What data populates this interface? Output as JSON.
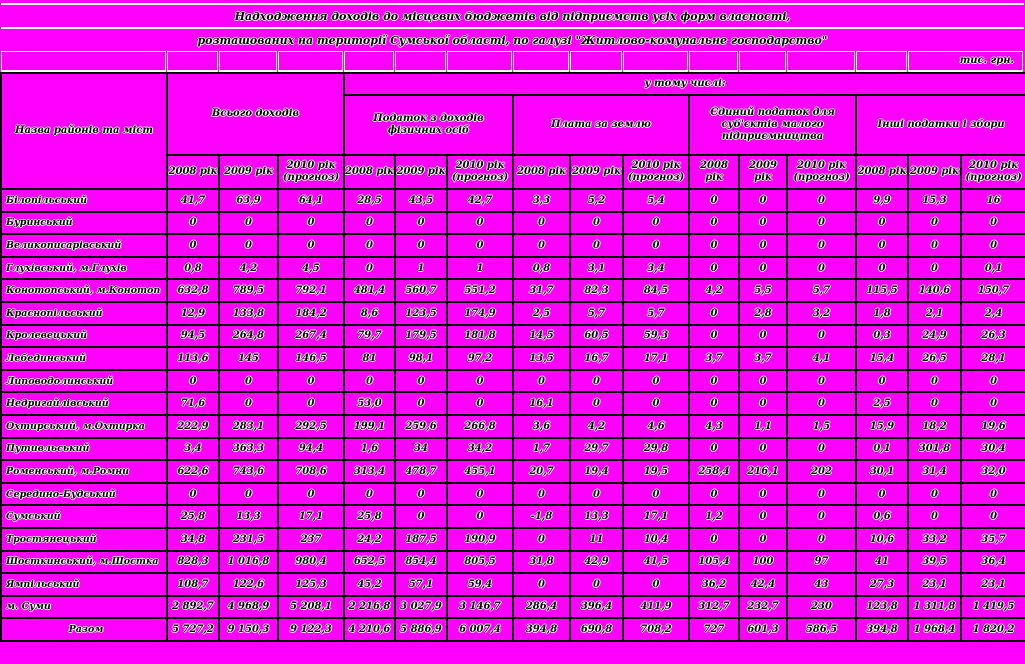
{
  "title_line1": "Надходження доходів до місцевих бюджетів від підприємств усіх форм власності,",
  "title_line2": "розташованих на території Сумської області, по галузі \"Житлово-комунальне господарство\"",
  "unit": "тис. грн.",
  "header": {
    "name_col": "Назва районів та міст",
    "total_group": "Всього доходів",
    "including": "у тому числі:",
    "groups": [
      "Податок з доходів фізичних осіб",
      "Плата за землю",
      "Єдиний податок для суб'єктів малого підприємництва",
      "Інші податки і збори"
    ],
    "years": [
      "2008 рік",
      "2009 рік",
      "2010 рік (прогноз)"
    ]
  },
  "rows": [
    {
      "name": "Білопільський",
      "v": [
        "41,7",
        "63,9",
        "64,1",
        "28,5",
        "43,5",
        "42,7",
        "3,3",
        "5,2",
        "5,4",
        "0",
        "0",
        "0",
        "9,9",
        "15,3",
        "16"
      ]
    },
    {
      "name": "Буринський",
      "v": [
        "0",
        "0",
        "0",
        "0",
        "0",
        "0",
        "0",
        "0",
        "0",
        "0",
        "0",
        "0",
        "0",
        "0",
        "0"
      ]
    },
    {
      "name": "Великописарівський",
      "v": [
        "0",
        "0",
        "0",
        "0",
        "0",
        "0",
        "0",
        "0",
        "0",
        "0",
        "0",
        "0",
        "0",
        "0",
        "0"
      ]
    },
    {
      "name": "Глухівський, м.Глухів",
      "v": [
        "0,8",
        "4,2",
        "4,5",
        "0",
        "1",
        "1",
        "0,8",
        "3,1",
        "3,4",
        "0",
        "0",
        "0",
        "0",
        "0",
        "0,1"
      ]
    },
    {
      "name": "Конотопський, м.Конотоп",
      "v": [
        "632,8",
        "789,5",
        "792,1",
        "481,4",
        "560,7",
        "551,2",
        "31,7",
        "82,3",
        "84,5",
        "4,2",
        "5,5",
        "5,7",
        "115,5",
        "140,6",
        "150,7"
      ]
    },
    {
      "name": "Краснопільський",
      "v": [
        "12,9",
        "133,8",
        "184,2",
        "8,6",
        "123,5",
        "174,9",
        "2,5",
        "5,7",
        "5,7",
        "0",
        "2,8",
        "3,2",
        "1,8",
        "2,1",
        "2,4"
      ]
    },
    {
      "name": "Кролевецький",
      "v": [
        "94,5",
        "264,8",
        "267,4",
        "79,7",
        "179,5",
        "181,8",
        "14,5",
        "60,5",
        "59,3",
        "0",
        "0",
        "0",
        "0,3",
        "24,9",
        "26,3"
      ]
    },
    {
      "name": "Лебединський",
      "v": [
        "113,6",
        "145",
        "146,5",
        "81",
        "98,1",
        "97,2",
        "13,5",
        "16,7",
        "17,1",
        "3,7",
        "3,7",
        "4,1",
        "15,4",
        "26,5",
        "28,1"
      ]
    },
    {
      "name": "Липоводолинський",
      "v": [
        "0",
        "0",
        "0",
        "0",
        "0",
        "0",
        "0",
        "0",
        "0",
        "0",
        "0",
        "0",
        "0",
        "0",
        "0"
      ]
    },
    {
      "name": "Недригайлівський",
      "v": [
        "71,6",
        "0",
        "0",
        "53,0",
        "0",
        "0",
        "16,1",
        "0",
        "0",
        "0",
        "0",
        "0",
        "2,5",
        "0",
        "0"
      ]
    },
    {
      "name": "Охтирський, м.Охтирка",
      "v": [
        "222,9",
        "283,1",
        "292,5",
        "199,1",
        "259,6",
        "266,8",
        "3,6",
        "4,2",
        "4,6",
        "4,3",
        "1,1",
        "1,5",
        "15,9",
        "18,2",
        "19,6"
      ]
    },
    {
      "name": "Путивльський",
      "v": [
        "3,4",
        "363,3",
        "94,4",
        "1,6",
        "34",
        "34,2",
        "1,7",
        "29,7",
        "29,8",
        "0",
        "0",
        "0",
        "0,1",
        "301,8",
        "30,4"
      ]
    },
    {
      "name": "Роменський, м.Ромни",
      "v": [
        "622,6",
        "743,6",
        "708,6",
        "313,4",
        "478,7",
        "455,1",
        "20,7",
        "19,4",
        "19,5",
        "258,4",
        "216,1",
        "202",
        "30,1",
        "31,4",
        "32,0"
      ]
    },
    {
      "name": "Середино-Будський",
      "v": [
        "0",
        "0",
        "0",
        "0",
        "0",
        "0",
        "0",
        "0",
        "0",
        "0",
        "0",
        "0",
        "0",
        "0",
        "0"
      ]
    },
    {
      "name": "Сумський",
      "v": [
        "25,8",
        "13,3",
        "17,1",
        "25,8",
        "0",
        "0",
        "-1,8",
        "13,3",
        "17,1",
        "1,2",
        "0",
        "0",
        "0,6",
        "0",
        "0"
      ]
    },
    {
      "name": "Тростянецький",
      "v": [
        "34,8",
        "231,5",
        "237",
        "24,2",
        "187,5",
        "190,9",
        "0",
        "11",
        "10,4",
        "0",
        "0",
        "0",
        "10,6",
        "33,2",
        "35,7"
      ]
    },
    {
      "name": "Шосткинський, м.Шостка",
      "v": [
        "828,3",
        "1 016,8",
        "980,4",
        "652,5",
        "854,4",
        "805,5",
        "31,8",
        "42,9",
        "41,5",
        "105,4",
        "100",
        "97",
        "41",
        "39,5",
        "36,4"
      ]
    },
    {
      "name": "Ямпільський",
      "v": [
        "108,7",
        "122,6",
        "125,3",
        "45,2",
        "57,1",
        "59,4",
        "0",
        "0",
        "0",
        "36,2",
        "42,4",
        "43",
        "27,3",
        "23,1",
        "23,1"
      ]
    },
    {
      "name": "м. Суми",
      "v": [
        "2 892,7",
        "4 968,9",
        "5 208,1",
        "2 216,8",
        "3 027,9",
        "3 146,7",
        "286,4",
        "396,4",
        "411,9",
        "312,7",
        "232,7",
        "230",
        "123,8",
        "1 311,8",
        "1 419,5"
      ]
    }
  ],
  "total": {
    "name": "Разом",
    "v": [
      "5 727,2",
      "9 150,3",
      "9 122,3",
      "4 210,6",
      "5 886,9",
      "6 007,4",
      "394,8",
      "690,8",
      "708,2",
      "727",
      "601,3",
      "586,5",
      "394,8",
      "1 968,4",
      "1 820,2"
    ]
  }
}
